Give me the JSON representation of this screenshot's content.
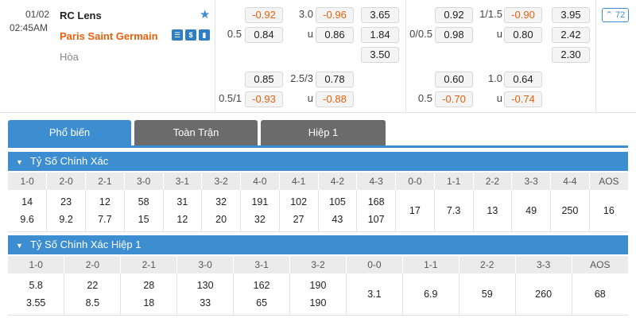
{
  "match": {
    "date": "01/02",
    "time": "02:45AM",
    "home": "RC Lens",
    "away": "Paris Saint Germain",
    "draw": "Hòa",
    "more_count": "72",
    "more_prefix": "^",
    "icons": [
      "list-icon",
      "dollar-icon",
      "chart-icon"
    ]
  },
  "odds": {
    "ft_hdp_row1": {
      "hdp": "",
      "v": "-0.92"
    },
    "ft_ou_row1": {
      "line": "3.0",
      "v": "-0.96"
    },
    "ft_1x2_row1": "3.65",
    "ft_hdp_row2": {
      "hdp": "0.5",
      "v": "0.84"
    },
    "ft_ou_row2": {
      "line": "u",
      "v": "0.86"
    },
    "ft_1x2_row2": "1.84",
    "ft_1x2_row3": "3.50",
    "ft_hdp_alt1": {
      "hdp": "",
      "v": "0.85"
    },
    "ft_ou_alt1": {
      "line": "2.5/3",
      "v": "0.78"
    },
    "ft_hdp_alt2": {
      "hdp": "0.5/1",
      "v": "-0.93"
    },
    "ft_ou_alt2": {
      "line": "u",
      "v": "-0.88"
    },
    "h1_hdp_row1": {
      "hdp": "",
      "v": "0.92"
    },
    "h1_ou_row1": {
      "line": "1/1.5",
      "v": "-0.90"
    },
    "h1_1x2_row1": "3.95",
    "h1_hdp_row2": {
      "hdp": "0/0.5",
      "v": "0.98"
    },
    "h1_ou_row2": {
      "line": "u",
      "v": "0.80"
    },
    "h1_1x2_row2": "2.42",
    "h1_1x2_row3": "2.30",
    "h1_hdp_alt1": {
      "hdp": "",
      "v": "0.60"
    },
    "h1_ou_alt1": {
      "line": "1.0",
      "v": "0.64"
    },
    "h1_hdp_alt2": {
      "hdp": "0.5",
      "v": "-0.70"
    },
    "h1_ou_alt2": {
      "line": "u",
      "v": "-0.74"
    }
  },
  "tabs": [
    "Phổ biến",
    "Toàn Trận",
    "Hiệp 1"
  ],
  "sections": [
    {
      "title": "Tỷ Số Chính Xác",
      "headers": [
        "1-0",
        "2-0",
        "2-1",
        "3-0",
        "3-1",
        "3-2",
        "4-0",
        "4-1",
        "4-2",
        "4-3",
        "0-0",
        "1-1",
        "2-2",
        "3-3",
        "4-4",
        "AOS"
      ],
      "top": [
        "14",
        "23",
        "12",
        "58",
        "31",
        "32",
        "191",
        "102",
        "105",
        "168",
        "17",
        "7.3",
        "13",
        "49",
        "250",
        "16"
      ],
      "bottom": [
        "9.6",
        "9.2",
        "7.7",
        "15",
        "12",
        "20",
        "32",
        "27",
        "43",
        "107",
        "",
        "",
        "",
        "",
        "",
        ""
      ]
    },
    {
      "title": "Tỷ Số Chính Xác Hiệp 1",
      "headers": [
        "1-0",
        "2-0",
        "2-1",
        "3-0",
        "3-1",
        "3-2",
        "0-0",
        "1-1",
        "2-2",
        "3-3",
        "AOS"
      ],
      "top": [
        "5.8",
        "22",
        "28",
        "130",
        "162",
        "190",
        "3.1",
        "6.9",
        "59",
        "260",
        "68"
      ],
      "bottom": [
        "3.55",
        "8.5",
        "18",
        "33",
        "65",
        "190",
        "",
        "",
        "",
        "",
        ""
      ]
    }
  ],
  "colors": {
    "accent": "#3d8ed0",
    "negative": "#e8600b",
    "tab_inactive": "#6b6b6b"
  }
}
